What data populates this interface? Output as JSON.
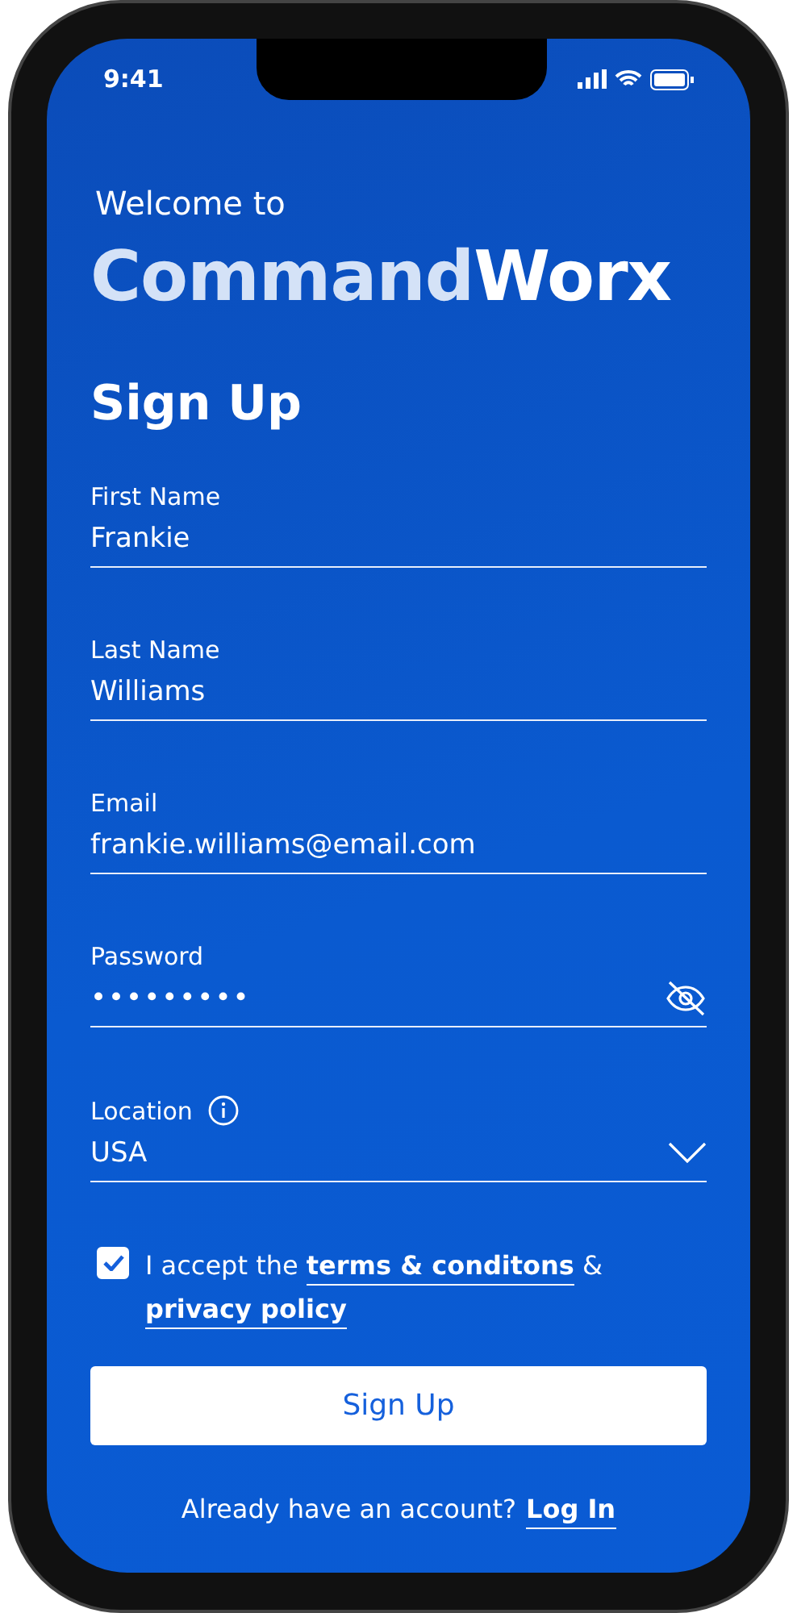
{
  "status_bar": {
    "time": "9:41"
  },
  "header": {
    "welcome": "Welcome to",
    "brand": [
      {
        "text": "Command",
        "kind": "light"
      },
      {
        "text": "Worx",
        "kind": "bright"
      }
    ]
  },
  "title": "Sign Up",
  "fields": [
    {
      "label": "First Name",
      "value": "Frankie",
      "kind": "text"
    },
    {
      "label": "Last Name",
      "value": "Williams",
      "kind": "text"
    },
    {
      "label": "Email",
      "value": "frankie.williams@email.com",
      "kind": "text"
    },
    {
      "label": "Password",
      "value": "•••••••••",
      "kind": "password"
    },
    {
      "label": "Location",
      "value": "USA",
      "kind": "select"
    }
  ],
  "terms": {
    "checked": true,
    "parts": [
      {
        "text": "I accept the ",
        "kind": "text"
      },
      {
        "text": "terms & conditons",
        "kind": "link"
      },
      {
        "text": " & ",
        "kind": "text"
      },
      {
        "text": "privacy policy",
        "kind": "link"
      }
    ]
  },
  "button": "Sign Up",
  "footer": {
    "text": "Already have an account?",
    "link": "Log In"
  }
}
